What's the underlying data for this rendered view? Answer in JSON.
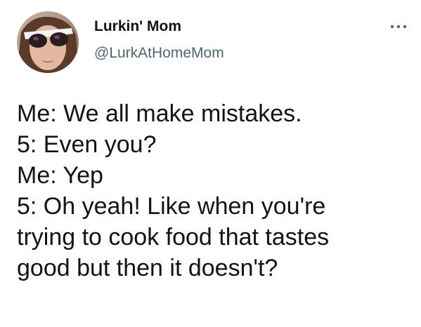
{
  "author": {
    "display_name": "Lurkin' Mom",
    "handle": "@LurkAtHomeMom",
    "avatar_icon": "avatar-photo"
  },
  "more_icon": "more-horizontal-icon",
  "tweet": {
    "lines": [
      "Me: We all make mistakes.",
      "5: Even you?",
      "Me: Yep",
      "5: Oh yeah! Like when you're",
      "trying to cook food that tastes",
      "good but then it doesn't?"
    ]
  },
  "colors": {
    "text": "#0f1419",
    "secondary": "#536471",
    "background": "#ffffff"
  }
}
